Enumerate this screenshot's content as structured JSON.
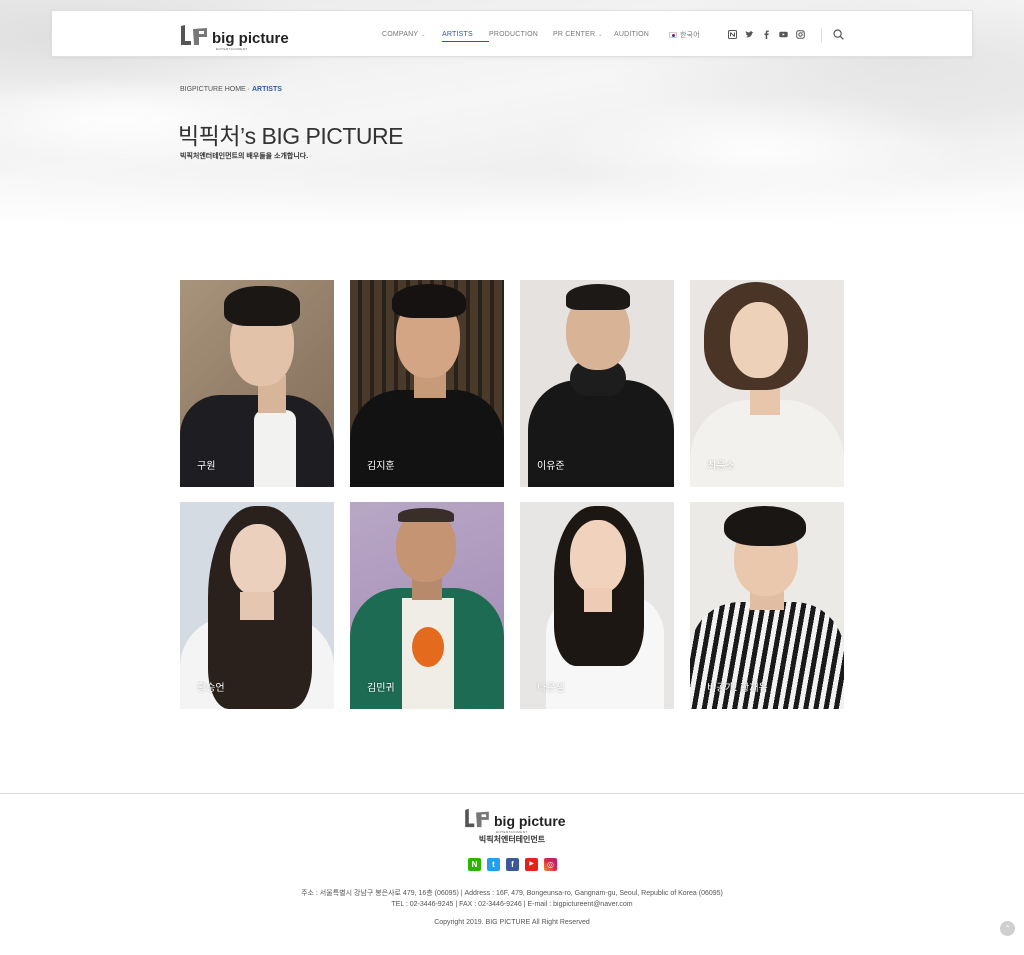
{
  "brand": {
    "name": "big picture",
    "sub": "ENTERTAINMENT"
  },
  "nav": {
    "items": [
      {
        "label": "COMPANY",
        "dropdown": true
      },
      {
        "label": "ARTISTS",
        "active": true
      },
      {
        "label": "PRODUCTION"
      },
      {
        "label": "PR CENTER",
        "dropdown": true
      },
      {
        "label": "AUDITION"
      },
      {
        "label": "한국어",
        "flag": "kr"
      }
    ],
    "social_icons": [
      "naver-blog-icon",
      "twitter-icon",
      "facebook-icon",
      "youtube-icon",
      "instagram-icon"
    ],
    "search_icon": "search-icon"
  },
  "breadcrumb": {
    "home": "BIGPICTURE HOME",
    "sep": " · ",
    "current": "ARTISTS"
  },
  "hero": {
    "title": "빅픽처’s BIG PICTURE",
    "subtitle": "빅픽처엔터테인먼트의 배우들을 소개합니다."
  },
  "artists": [
    {
      "name": "구원"
    },
    {
      "name": "김지훈"
    },
    {
      "name": "이유준"
    },
    {
      "name": "최윤소"
    },
    {
      "name": "황승언"
    },
    {
      "name": "김민귀"
    },
    {
      "name": "나은샘"
    },
    {
      "name": "비공개: 황재욱"
    }
  ],
  "footer": {
    "brand": "big picture",
    "brand_sub": "ENTERTAINMENT",
    "company": "빅픽처엔터테인먼트",
    "address": "주소 : 서울특별시 강남구 봉은사로 479, 16층 (06095) | Address : 16F, 479, Bongeunsa-ro, Gangnam-gu, Seoul, Republic of Korea (06095)",
    "contact": "TEL : 02-3446-9245 | FAX : 02-3446-9246 | E-mail : bigpictureent@naver.com",
    "copyright": "Copyright 2019. BIG PICTURE All Right Reserved",
    "social": [
      {
        "icon": "naver-icon",
        "glyph": "N",
        "color": "#2db400"
      },
      {
        "icon": "twitter-icon",
        "glyph": "t",
        "color": "#1da1f2"
      },
      {
        "icon": "facebook-icon",
        "glyph": "f",
        "color": "#3b5998"
      },
      {
        "icon": "youtube-icon",
        "glyph": "▶",
        "color": "#e62117"
      },
      {
        "icon": "instagram-icon",
        "glyph": "◎",
        "color": "#d6249f"
      }
    ]
  },
  "colors": {
    "accent": "#2c5aa0",
    "text": "#333333"
  }
}
